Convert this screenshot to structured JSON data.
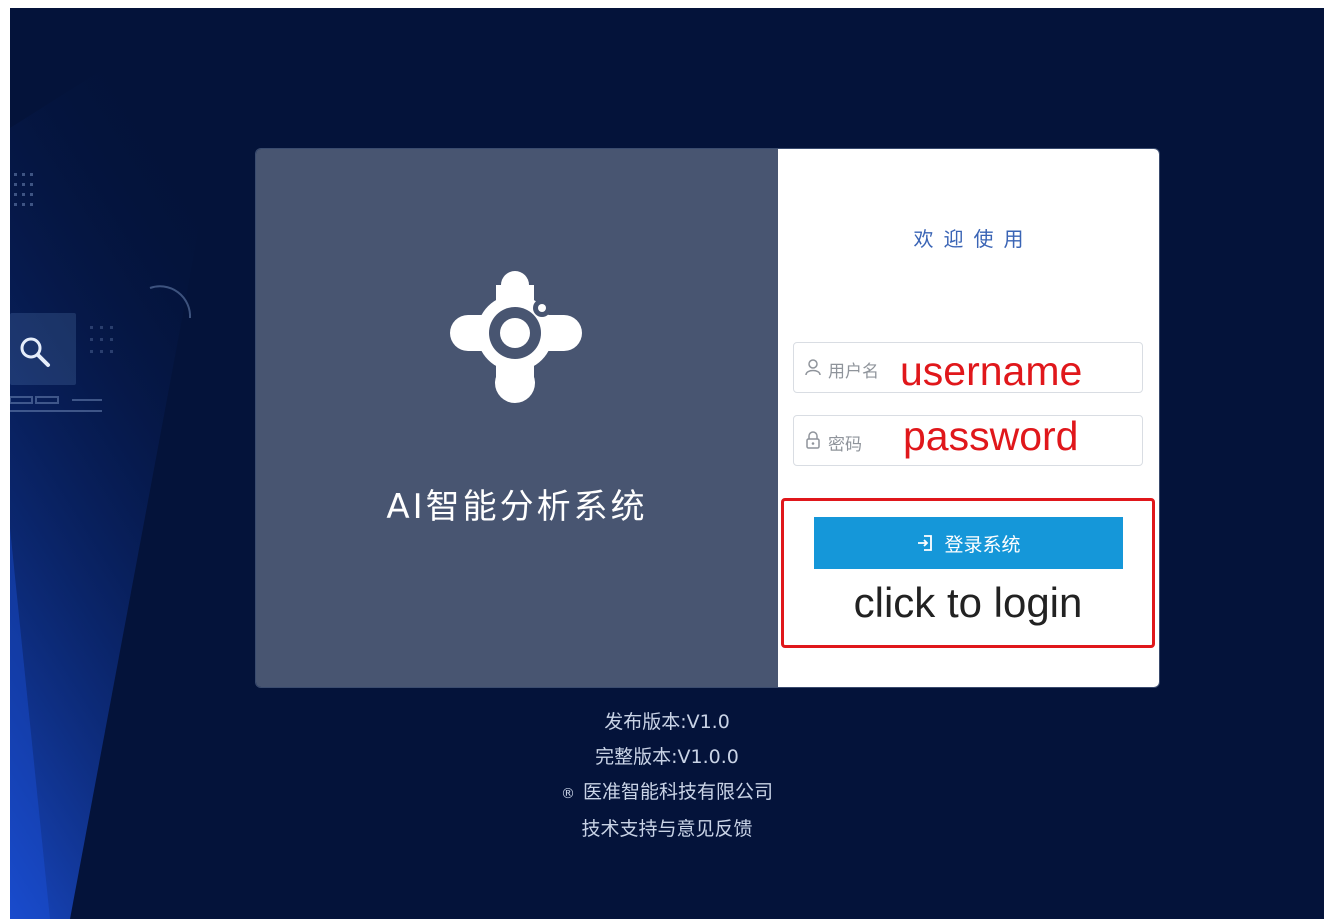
{
  "brand": {
    "system_title": "AI智能分析系统",
    "logo_icon": "cluster-logo-icon"
  },
  "login": {
    "welcome": "欢迎使用",
    "username_placeholder": "用户名",
    "password_placeholder": "密码",
    "submit_label": "登录系统",
    "username_icon": "user-icon",
    "password_icon": "lock-icon",
    "submit_icon": "sign-in-icon"
  },
  "annotations": {
    "username": "username",
    "password": "password",
    "click_hint": "click to login"
  },
  "footer": {
    "release_version": "发布版本:V1.0",
    "full_version": "完整版本:V1.0.0",
    "copyright_symbol": "®",
    "company": "医准智能科技有限公司",
    "support_link": "技术支持与意见反馈"
  },
  "colors": {
    "background": "#04133a",
    "left_panel": "#485571",
    "button": "#1597d9",
    "annotation_red": "#e0171b",
    "welcome_text": "#3a64b5"
  }
}
